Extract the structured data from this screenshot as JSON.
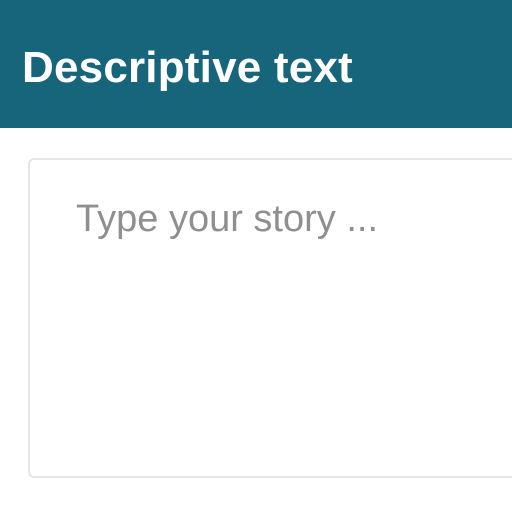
{
  "header": {
    "title": "Descriptive text",
    "background_color": "#17657b",
    "title_color": "#ffffff"
  },
  "story": {
    "value": "",
    "placeholder": "Type your story ..."
  }
}
